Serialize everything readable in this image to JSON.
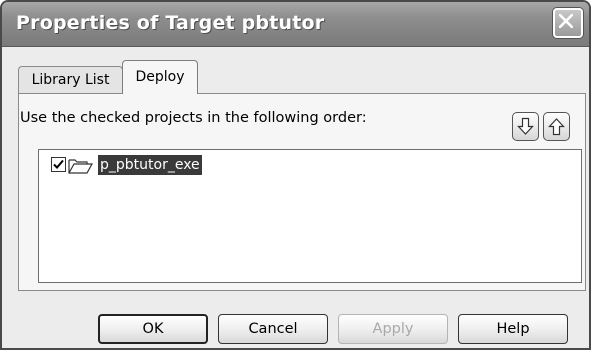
{
  "window": {
    "title": "Properties of Target pbtutor"
  },
  "tabs": [
    {
      "label": "Library List",
      "active": false
    },
    {
      "label": "Deploy",
      "active": true
    }
  ],
  "deploy": {
    "instruction": "Use the checked projects in the following order:",
    "move_down_icon": "arrow-down-icon",
    "move_up_icon": "arrow-up-icon",
    "projects": [
      {
        "name": "p_pbtutor_exe",
        "checked": true,
        "selected": true
      }
    ]
  },
  "buttons": {
    "ok": "OK",
    "cancel": "Cancel",
    "apply": "Apply",
    "help": "Help"
  },
  "colors": {
    "titlebar": "#8e8e8e",
    "selection": "#3a3a3a"
  }
}
